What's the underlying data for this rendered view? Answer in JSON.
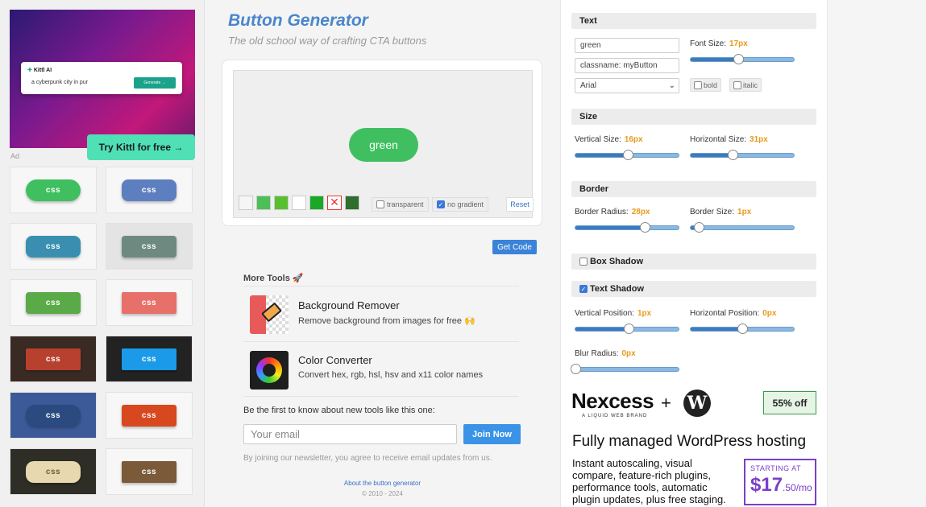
{
  "ad": {
    "brand": "Kittl AI",
    "prompt": "a cyberpunk city in pur",
    "generate_label": "Generate →",
    "try_label": "Try Kittl for free →",
    "ad_label": "Ad"
  },
  "gallery": {
    "tile_label": "css",
    "tiles": [
      {
        "bg": "#3fbf5f",
        "tile_bg": "#f7f7f7",
        "radius": "14px"
      },
      {
        "bg": "#5d7fbf",
        "tile_bg": "#f7f7f7",
        "radius": "8px"
      },
      {
        "bg": "#3a8fb0",
        "tile_bg": "#f7f7f7",
        "radius": "8px"
      },
      {
        "bg": "#6e8a80",
        "tile_bg": "#e4e4e4",
        "radius": "4px"
      },
      {
        "bg": "#5aaa48",
        "tile_bg": "#f7f7f7",
        "radius": "4px"
      },
      {
        "bg": "#e8706a",
        "tile_bg": "#f7f7f7",
        "radius": "2px"
      },
      {
        "bg": "#b8402e",
        "tile_bg": "#3a2a24",
        "radius": "2px"
      },
      {
        "bg": "#1a9ae8",
        "tile_bg": "#222222",
        "radius": "2px"
      },
      {
        "bg": "#2a4a80",
        "tile_bg": "#3d5a98",
        "radius": "12px"
      },
      {
        "bg": "#d8481e",
        "tile_bg": "#f7f7f7",
        "radius": "3px"
      },
      {
        "bg": "#e8d8b0",
        "tile_bg": "#2e2e26",
        "radius": "10px"
      },
      {
        "bg": "#7a5a38",
        "tile_bg": "#f7f7f7",
        "radius": "2px"
      }
    ]
  },
  "header": {
    "title": "Button Generator",
    "subtitle": "The old school way of crafting CTA buttons"
  },
  "preview": {
    "button_text": "green",
    "swatches": [
      "#f5f5f5",
      "#4cbf58",
      "#58c030",
      "#ffffff",
      "#1aa826",
      "remove",
      "#2e6e2e"
    ],
    "transparent_label": "transparent",
    "no_gradient_label": "no gradient",
    "reset_label": "Reset",
    "get_code_label": "Get Code"
  },
  "more_tools": {
    "title": "More Tools 🚀",
    "tools": [
      {
        "title": "Background Remover",
        "desc": "Remove background from images for free 🙌"
      },
      {
        "title": "Color Converter",
        "desc": "Convert hex, rgb, hsl, hsv and x11 color names"
      }
    ]
  },
  "newsletter": {
    "text": "Be the first to know about new tools like this one:",
    "email_placeholder": "Your email",
    "join_label": "Join Now",
    "note": "By joining our newsletter, you agree to receive email updates from us."
  },
  "footer": {
    "about": "About the button generator",
    "copyright": "© 2010 - 2024"
  },
  "settings": {
    "text_section": "Text",
    "text_value": "green",
    "classname_value": "classname: myButton",
    "font_value": "Arial",
    "font_size_label": "Font Size:",
    "font_size_value": "17px",
    "font_size_level": 0.45,
    "bold_label": "bold",
    "italic_label": "italic",
    "size_section": "Size",
    "vertical_size_label": "Vertical Size:",
    "vertical_size_value": "16px",
    "vertical_size_level": 0.5,
    "horizontal_size_label": "Horizontal Size:",
    "horizontal_size_value": "31px",
    "horizontal_size_level": 0.4,
    "border_section": "Border",
    "border_radius_label": "Border Radius:",
    "border_radius_value": "28px",
    "border_radius_level": 0.66,
    "border_size_label": "Border Size:",
    "border_size_value": "1px",
    "border_size_level": 0.08,
    "box_shadow_label": "Box Shadow",
    "text_shadow_label": "Text Shadow",
    "vertical_position_label": "Vertical Position:",
    "vertical_position_value": "1px",
    "vertical_position_level": 0.51,
    "horizontal_position_label": "Horizontal Position:",
    "horizontal_position_value": "0px",
    "horizontal_position_level": 0.49,
    "blur_radius_label": "Blur Radius:",
    "blur_radius_value": "0px",
    "blur_radius_level": 0.0
  },
  "nexcess_ad": {
    "logo": "Nexcess",
    "tagline": "A LIQUID WEB BRAND",
    "plus": "+",
    "wp": "W",
    "discount": "55% off",
    "headline": "Fully managed WordPress hosting",
    "body": "Instant autoscaling, visual compare, feature-rich plugins, performance tools, automatic plugin updates, plus free staging.",
    "starting_at": "STARTING AT",
    "price": "$17",
    "price_suffix": ".50/mo"
  }
}
